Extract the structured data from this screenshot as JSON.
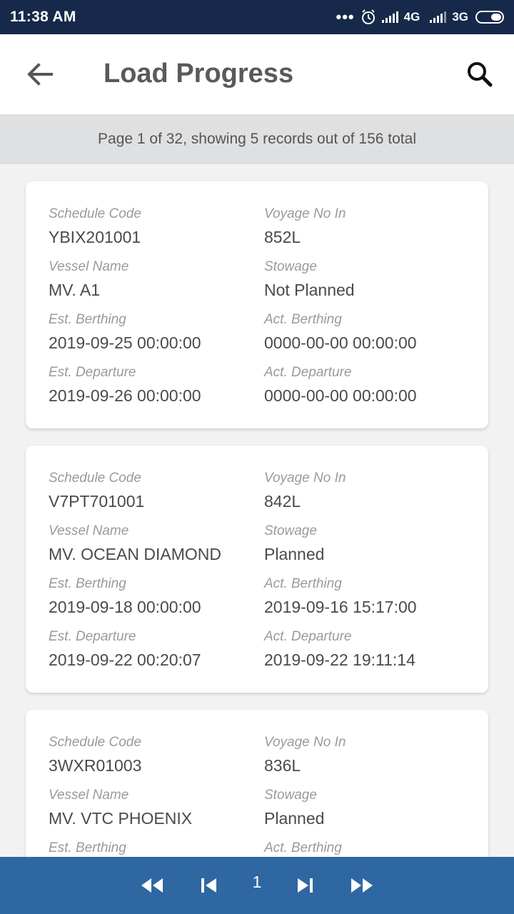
{
  "status_bar": {
    "time": "11:38 AM",
    "network_1": "4G",
    "network_2": "3G"
  },
  "header": {
    "title": "Load Progress"
  },
  "pagination_info": "Page 1 of 32, showing 5 records out of 156 total",
  "labels": {
    "schedule_code": "Schedule Code",
    "voyage_no_in": "Voyage No In",
    "vessel_name": "Vessel Name",
    "stowage": "Stowage",
    "est_berthing": "Est. Berthing",
    "act_berthing": "Act. Berthing",
    "est_departure": "Est. Departure",
    "act_departure": "Act. Departure"
  },
  "records": [
    {
      "schedule_code": "YBIX201001",
      "voyage_no_in": "852L",
      "vessel_name": "MV. A1",
      "stowage": "Not Planned",
      "est_berthing": "2019-09-25 00:00:00",
      "act_berthing": "0000-00-00 00:00:00",
      "est_departure": "2019-09-26 00:00:00",
      "act_departure": "0000-00-00 00:00:00"
    },
    {
      "schedule_code": "V7PT701001",
      "voyage_no_in": "842L",
      "vessel_name": "MV. OCEAN DIAMOND",
      "stowage": "Planned",
      "est_berthing": "2019-09-18 00:00:00",
      "act_berthing": "2019-09-16 15:17:00",
      "est_departure": "2019-09-22 00:20:07",
      "act_departure": "2019-09-22 19:11:14"
    },
    {
      "schedule_code": "3WXR01003",
      "voyage_no_in": "836L",
      "vessel_name": "MV. VTC PHOENIX",
      "stowage": "Planned",
      "est_berthing": "",
      "act_berthing": "",
      "est_departure": "",
      "act_departure": ""
    }
  ],
  "footer": {
    "current_page": "1"
  },
  "icons": {
    "back": "arrow-left-icon",
    "search": "search-icon",
    "first": "double-chevron-left-icon",
    "prev": "skip-previous-icon",
    "next": "skip-next-icon",
    "last": "double-chevron-right-icon"
  },
  "colors": {
    "status_bar": "#17294a",
    "footer": "#2f67a3",
    "page_info_bg": "#dfe0e2"
  }
}
